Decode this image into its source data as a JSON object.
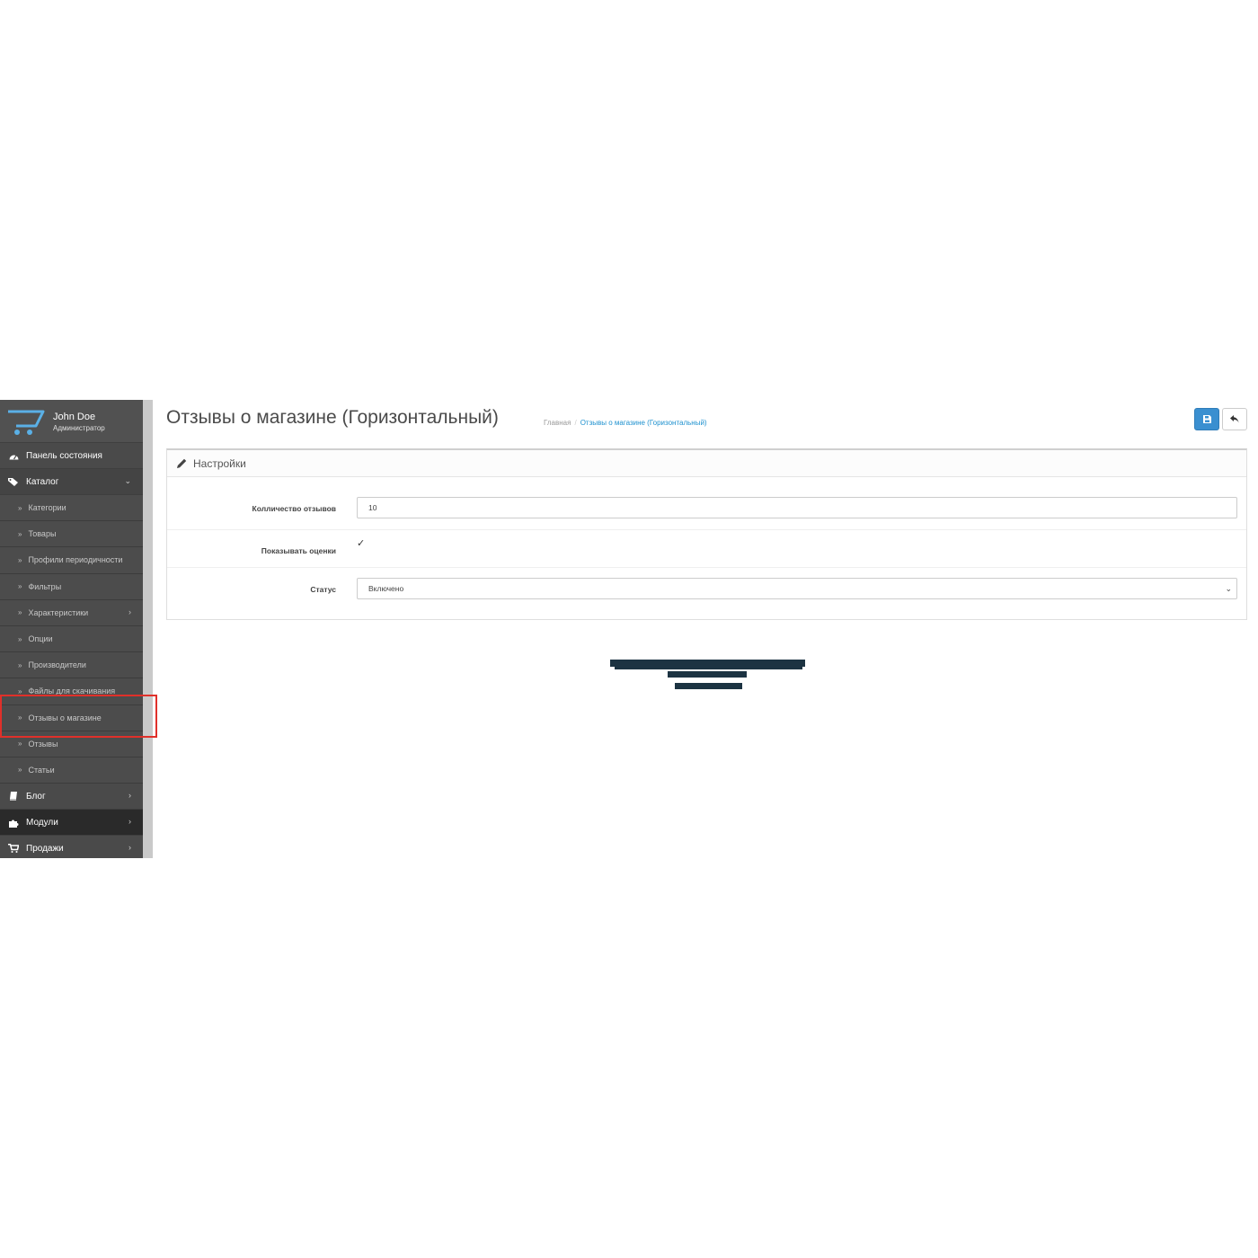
{
  "sidebar": {
    "profile": {
      "name": "John Doe",
      "role": "Администратор"
    },
    "menu": [
      {
        "label": "Панель состояния",
        "icon": "dashboard-icon"
      },
      {
        "label": "Каталог",
        "icon": "tags-icon",
        "expanded": true
      }
    ],
    "catalog_items": [
      {
        "label": "Категории"
      },
      {
        "label": "Товары"
      },
      {
        "label": "Профили периодичности"
      },
      {
        "label": "Фильтры"
      },
      {
        "label": "Характеристики",
        "has_children": true
      },
      {
        "label": "Опции"
      },
      {
        "label": "Производители"
      },
      {
        "label": "Файлы для скачивания"
      },
      {
        "label": "Отзывы о магазине",
        "highlighted": true
      },
      {
        "label": "Отзывы"
      },
      {
        "label": "Статьи"
      }
    ],
    "bottom_menu": [
      {
        "label": "Блог",
        "icon": "book-icon"
      },
      {
        "label": "Модули",
        "icon": "puzzle-icon",
        "active": true
      },
      {
        "label": "Продажи",
        "icon": "cart-icon"
      }
    ]
  },
  "header": {
    "title": "Отзывы о магазине (Горизонтальный)",
    "breadcrumb": [
      "Главная",
      "Отзывы о магазине (Горизонтальный)"
    ]
  },
  "panel": {
    "heading": "Настройки",
    "fields": {
      "count": {
        "label": "Колличество отзывов",
        "value": "10"
      },
      "show_ratings": {
        "label": "Показывать оценки",
        "checked": true
      },
      "status": {
        "label": "Статус",
        "value": "Включено"
      }
    }
  },
  "colors": {
    "sidebar_bg": "#4a4a4a",
    "primary_button": "#3a8fd0",
    "link": "#1e91cf",
    "highlight_border": "#e0302a"
  }
}
